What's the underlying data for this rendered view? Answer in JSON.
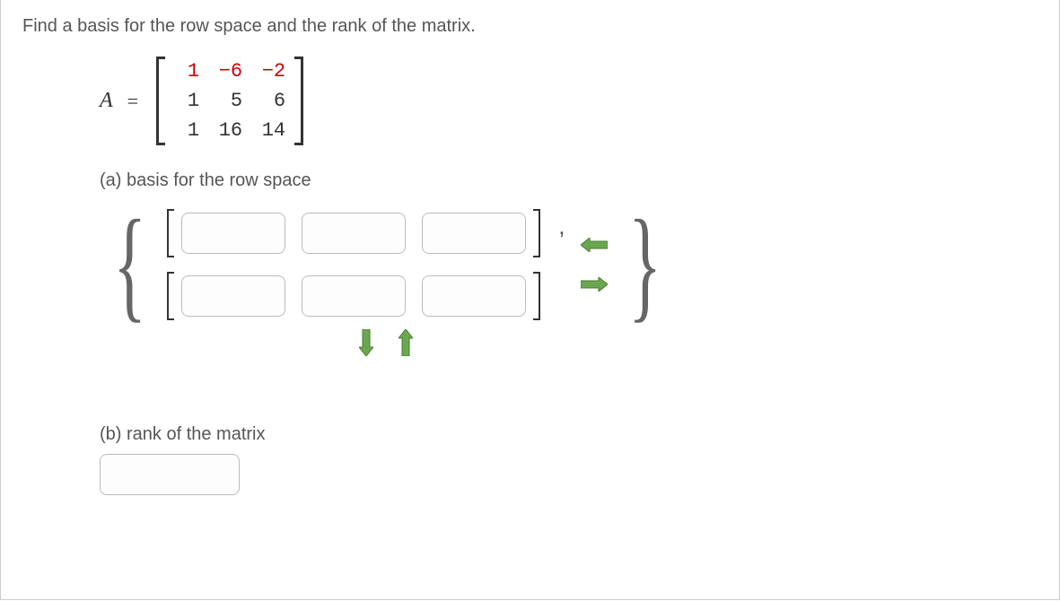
{
  "question": "Find a basis for the row space and the rank of the matrix.",
  "matrix_label": "A",
  "equals": "=",
  "matrix": {
    "rows": [
      [
        "1",
        "−6",
        "−2"
      ],
      [
        "1",
        "5",
        "6"
      ],
      [
        "1",
        "16",
        "14"
      ]
    ],
    "highlight_row": 0
  },
  "part_a_label": "(a) basis for the row space",
  "part_b_label": "(b) rank of the matrix",
  "basis_inputs": {
    "rows": 2,
    "cols": 3,
    "values": [
      [
        "",
        "",
        ""
      ],
      [
        "",
        "",
        ""
      ]
    ]
  },
  "rank_value": "",
  "icons": {
    "arrow_left": "arrow-left",
    "arrow_right": "arrow-right",
    "arrow_up": "arrow-up",
    "arrow_down": "arrow-down"
  }
}
